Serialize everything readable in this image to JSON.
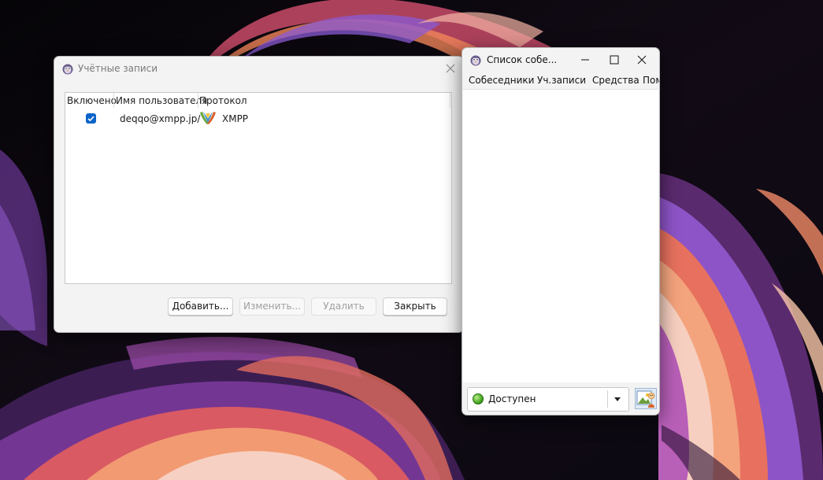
{
  "accounts_window": {
    "title": "Учётные записи",
    "columns": [
      "Включено",
      "Имя пользователя",
      "Протокол"
    ],
    "rows": [
      {
        "enabled": true,
        "username": "deqqo@xmpp.jp/",
        "protocol": "XMPP"
      }
    ],
    "buttons": {
      "add": "Добавить...",
      "edit": "Изменить...",
      "delete": "Удалить",
      "close": "Закрыть"
    }
  },
  "buddy_window": {
    "title": "Список собе...",
    "menu": [
      "Собеседники",
      "Уч.записи",
      "Средства",
      "Пом"
    ],
    "status": "Доступен"
  },
  "icons": {
    "app": "pidgin-icon",
    "protocol": "xmpp-icon",
    "status": "available-status-icon",
    "avatar": "buddy-icon"
  },
  "colors": {
    "checkbox": "#0a63c9",
    "available": "#3fa11b"
  }
}
